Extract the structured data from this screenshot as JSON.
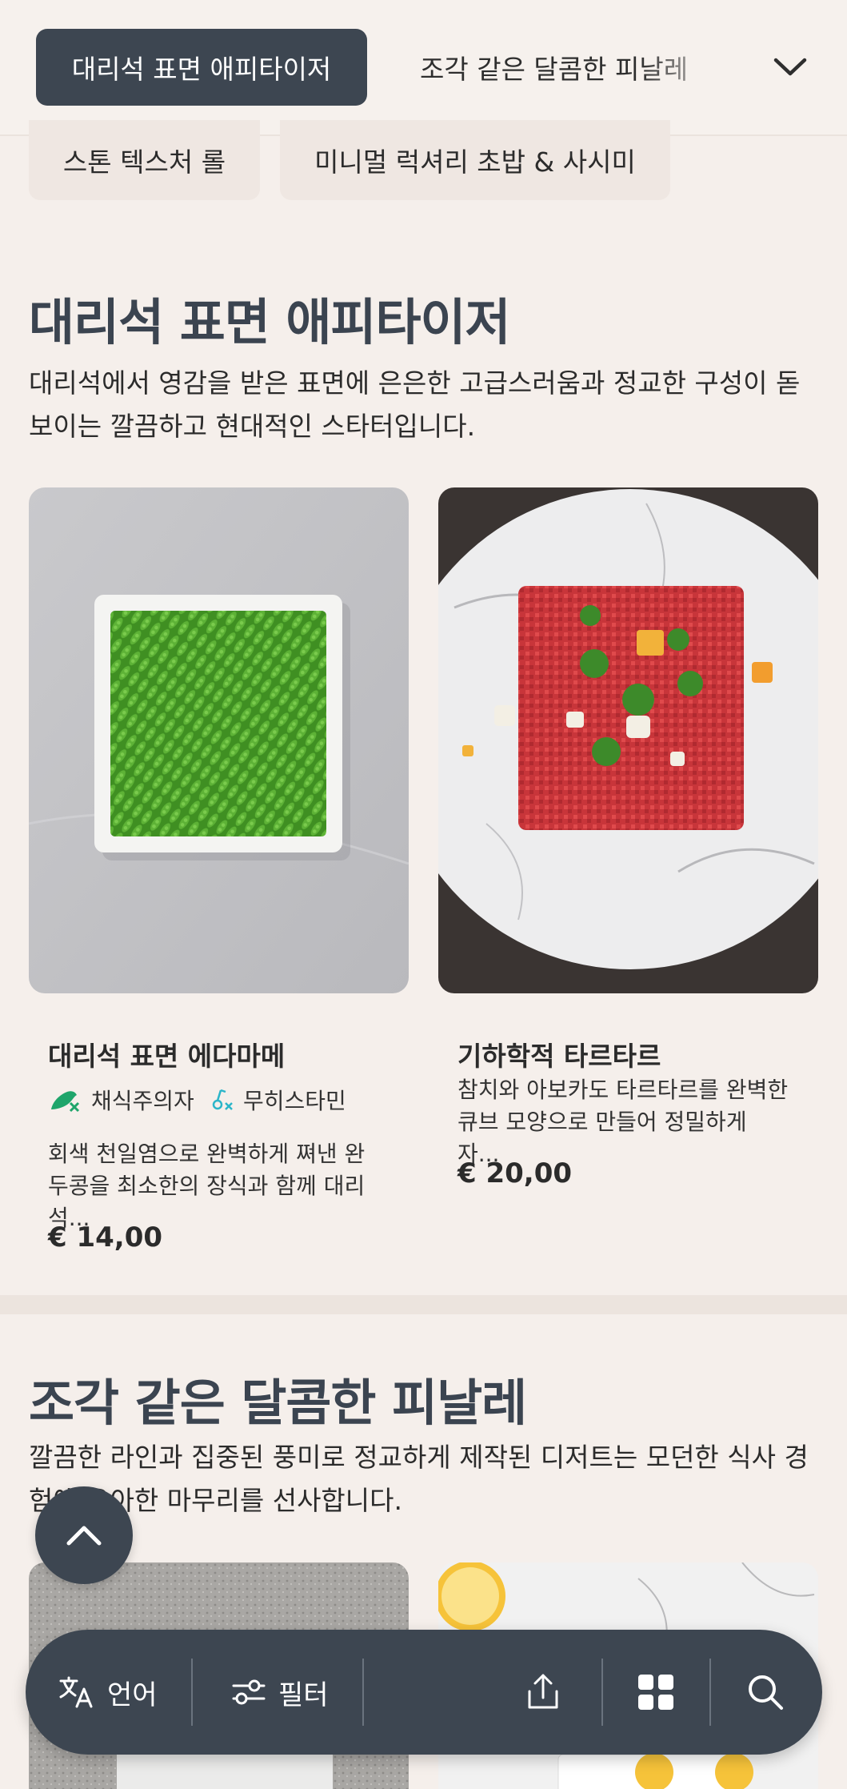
{
  "category_nav": {
    "active": "대리석 표면 애피타이저",
    "next": "조각 같은 달콤한 피날레",
    "chips": [
      "스톤 텍스처 롤",
      "미니멀 럭셔리 초밥 & 사시미"
    ],
    "toggle_icon": "chevron-down-icon"
  },
  "sections": [
    {
      "title": "대리석 표면 애피타이저",
      "description": "대리석에서 영감을 받은 표면에 은은한 고급스러움과 정교한 구성이 돋보이는 깔끔하고 현대적인 스타터입니다.",
      "items": [
        {
          "name": "대리석 표면 에다마메",
          "tags": [
            {
              "icon": "vegetarian-icon",
              "label": "채식주의자"
            },
            {
              "icon": "no-histamine-icon",
              "label": "무히스타민"
            }
          ],
          "description": "회색 천일염으로 완벽하게 쪄낸 완두콩을 최소한의 장식과 함께 대리석...",
          "price": "€ 14,00"
        },
        {
          "name": "기하학적 타르타르",
          "tags": [],
          "description": "참치와 아보카도 타르타르를 완벽한 큐브 모양으로 만들어 정밀하게 자...",
          "price": "€ 20,00"
        }
      ]
    },
    {
      "title": "조각 같은 달콤한 피날레",
      "description": "깔끔한 라인과 집중된 풍미로 정교하게 제작된 디저트는 모던한 식사 경험에 우아한 마무리를 선사합니다."
    }
  ],
  "bottom_bar": {
    "language_label": "언어",
    "language_icon": "translate-icon",
    "filter_label": "필터",
    "filter_icon": "filter-icon",
    "share_icon": "share-icon",
    "grid_icon": "grid-view-icon",
    "search_icon": "search-icon"
  },
  "scroll_top_icon": "chevron-up-icon",
  "colors": {
    "background": "#f5efeb",
    "accent_dark": "#3d4651",
    "vegetarian_green": "#1fa56b",
    "histamine_teal": "#2bb5c9"
  }
}
